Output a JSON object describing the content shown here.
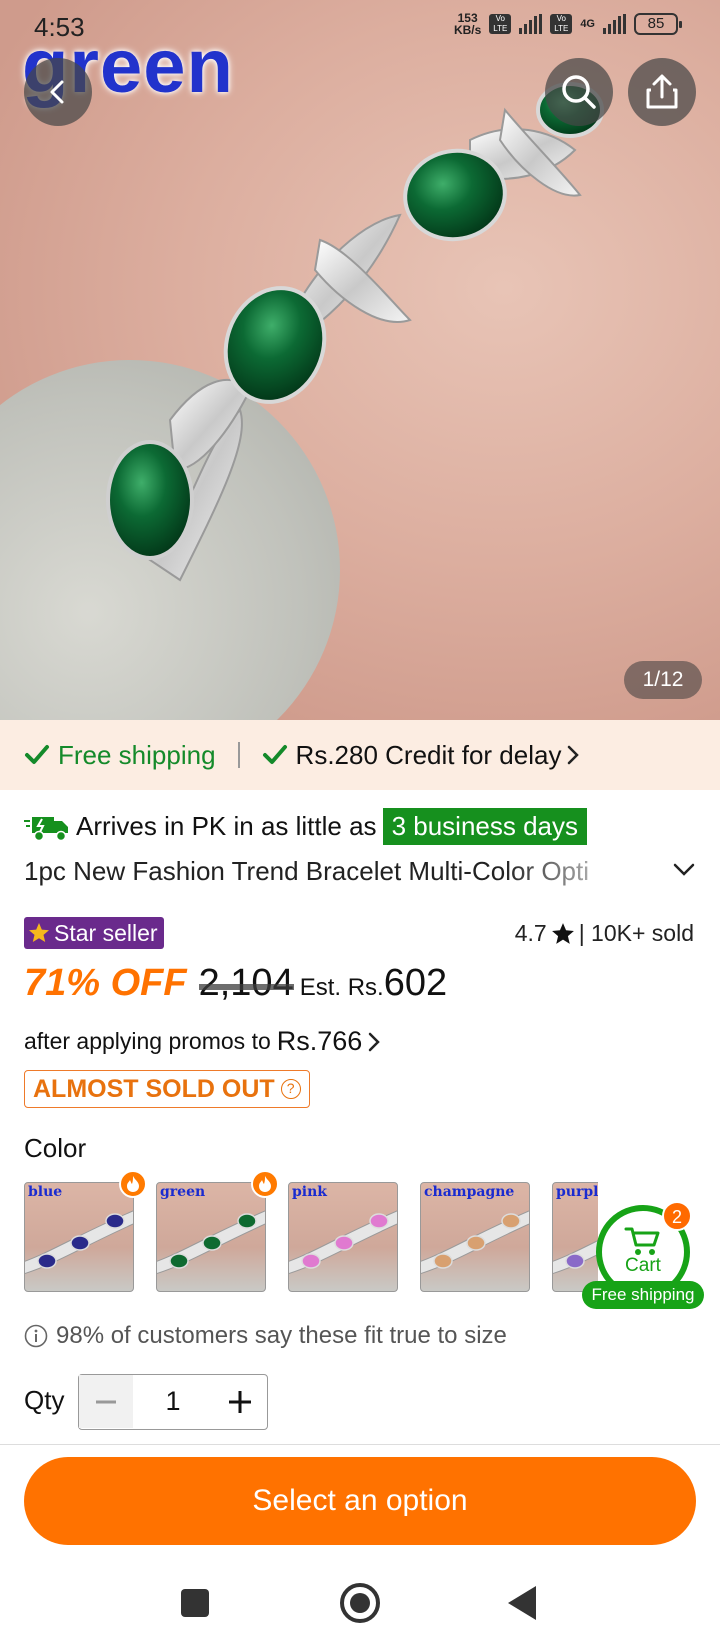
{
  "status_bar": {
    "time": "4:53",
    "net_speed_value": "153",
    "net_speed_unit": "KB/s",
    "volte_1": "Vo LTE",
    "volte_2": "Vo LTE",
    "network_type": "4G",
    "battery": "85"
  },
  "hero": {
    "overlay_text": "green",
    "image_counter": "1/12"
  },
  "shipping_bar": {
    "free_shipping": "Free shipping",
    "credit": "Rs.280 Credit for delay"
  },
  "arrival": {
    "text": "Arrives in PK in as little as",
    "highlight": "3 business days"
  },
  "product": {
    "title": "1pc New Fashion Trend Bracelet Multi-Color Opti",
    "star_seller": "Star seller",
    "rating": "4.7",
    "sold": "| 10K+ sold",
    "discount": "71% OFF",
    "original_price": "2,104",
    "est_label": "Est. Rs.",
    "price": "602",
    "promo_text": "after applying promos to",
    "promo_amount": "Rs.766",
    "sold_out_badge": "ALMOST SOLD OUT"
  },
  "colors": {
    "label": "Color",
    "options": [
      {
        "name": "blue",
        "gem": "#2a2a8a",
        "hot": true
      },
      {
        "name": "green",
        "gem": "#0e6a30",
        "hot": true
      },
      {
        "name": "pink",
        "gem": "#e07ad0",
        "hot": false
      },
      {
        "name": "champagne",
        "gem": "#d8a070",
        "hot": false
      },
      {
        "name": "purple",
        "gem": "#8a6ac8",
        "hot": false
      }
    ]
  },
  "cart": {
    "label": "Cart",
    "count": "2",
    "free_shipping": "Free shipping"
  },
  "fit_note": "98% of customers say these fit true to size",
  "quantity": {
    "label": "Qty",
    "value": "1"
  },
  "cta": "Select an option",
  "theme": {
    "accent": "#ff7200",
    "green": "#148a2a",
    "star_seller_bg": "#6a2a8c"
  }
}
